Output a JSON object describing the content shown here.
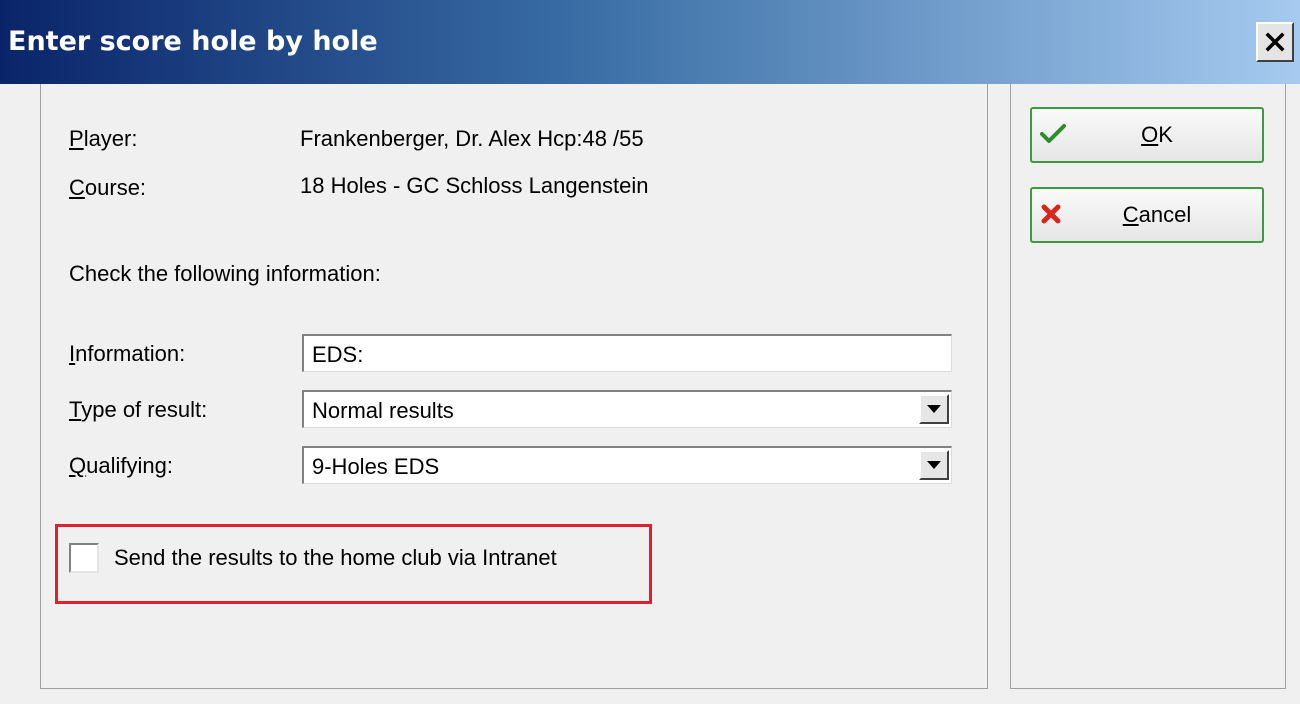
{
  "window": {
    "title": "Enter score hole by hole"
  },
  "player": {
    "label": "Player:",
    "label_mnemonic": "P",
    "label_rest": "layer:",
    "value": "Frankenberger, Dr. Alex Hcp:48  /55"
  },
  "course": {
    "label": "Course:",
    "label_mnemonic": "C",
    "label_rest": "ourse:",
    "value": "18 Holes - GC Schloss Langenstein"
  },
  "check_text": "Check the following information:",
  "information": {
    "label": "Information:",
    "label_mnemonic": "I",
    "label_rest": "nformation:",
    "value": "EDS:"
  },
  "type_of_result": {
    "label": "Type of result:",
    "label_mnemonic": "T",
    "label_rest": "ype of result:",
    "selected": "Normal results"
  },
  "qualifying": {
    "label": "Qualifying:",
    "label_mnemonic": "Q",
    "label_rest": "ualifying:",
    "selected": "9-Holes EDS"
  },
  "send_results": {
    "label": "Send the results to the home club via Intranet",
    "checked": false
  },
  "buttons": {
    "ok": {
      "label": "OK",
      "mnemonic": "O",
      "rest": "K",
      "icon": "checkmark-icon"
    },
    "cancel": {
      "label": "Cancel",
      "mnemonic": "C",
      "rest": "ancel",
      "icon": "cross-icon"
    }
  },
  "colors": {
    "highlight": "#e1202f",
    "ok_check": "#2e8b2e",
    "cancel_cross": "#d9261c"
  }
}
